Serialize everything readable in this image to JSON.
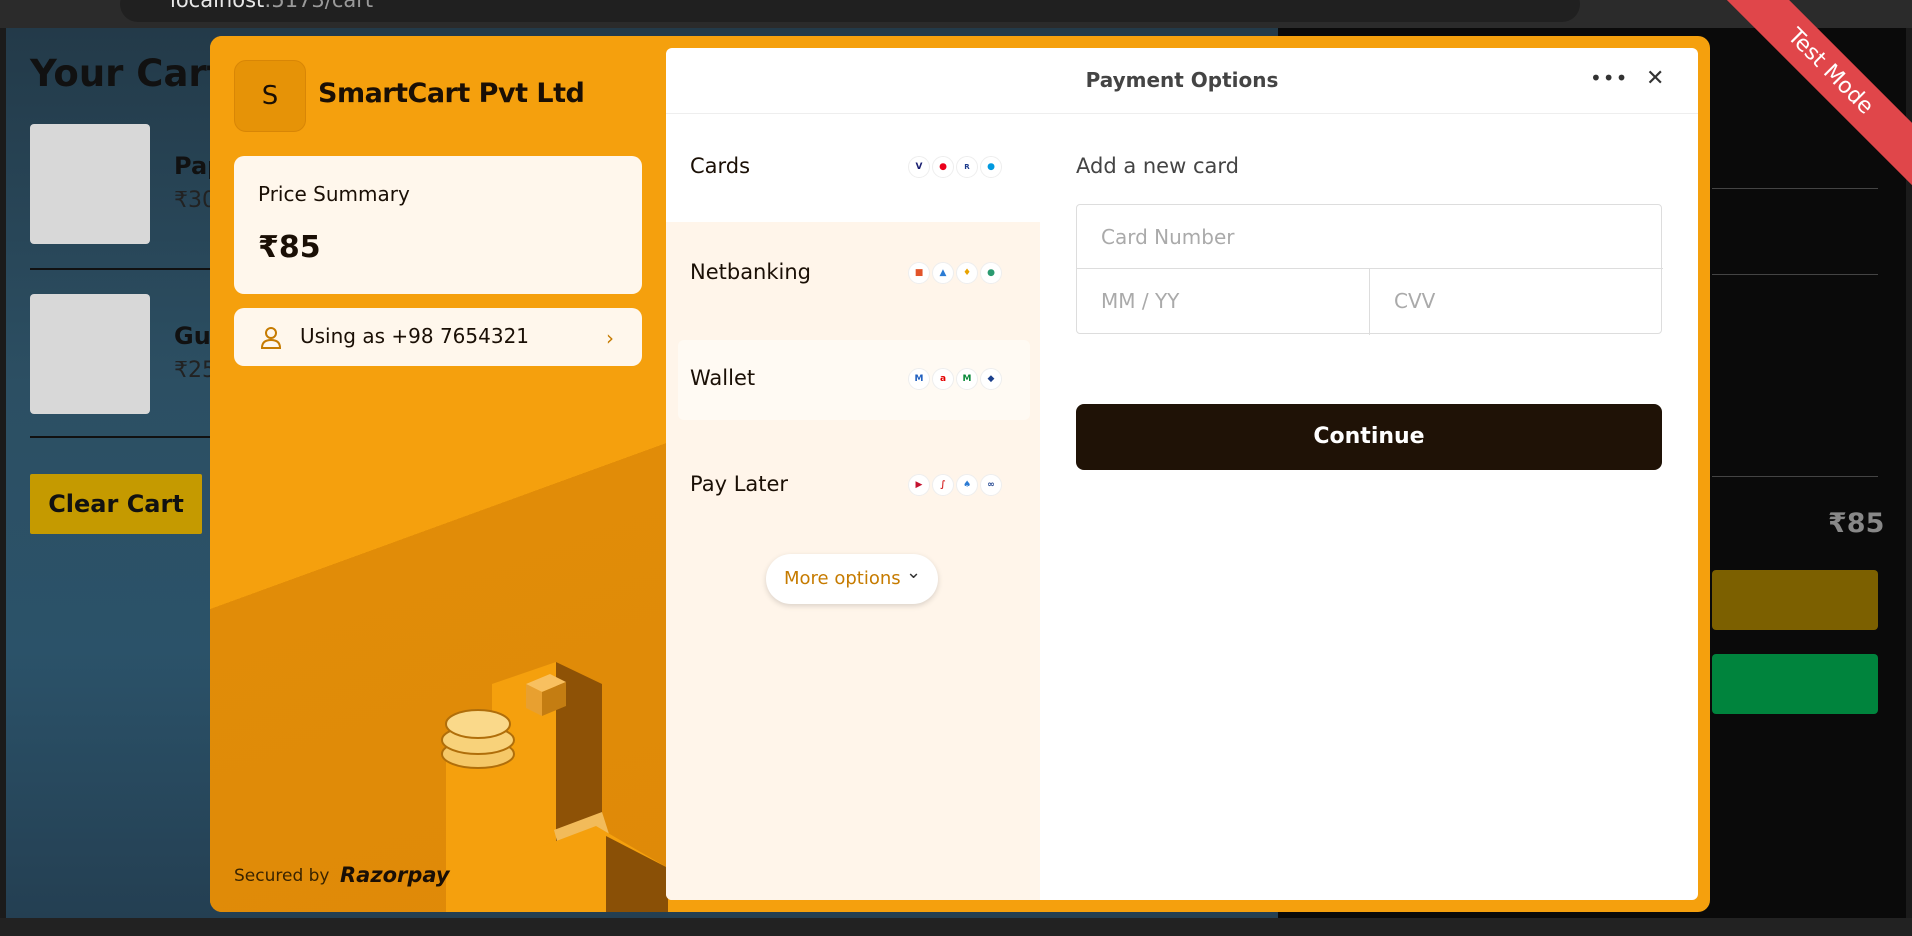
{
  "browser": {
    "url_host": "localhost",
    "url_path": ":5173/cart"
  },
  "page": {
    "title": "Your Cart",
    "items": [
      {
        "name": "Pap",
        "price": "₹30"
      },
      {
        "name": "Gu",
        "price": "₹25"
      }
    ],
    "clear_button": "Clear Cart",
    "summary_price": "₹85"
  },
  "checkout": {
    "test_mode_label": "Test Mode",
    "merchant": {
      "initial": "S",
      "name": "SmartCart Pvt Ltd"
    },
    "price_summary": {
      "label": "Price Summary",
      "amount": "₹85"
    },
    "user": {
      "text": "Using as +98 7654321"
    },
    "footer": {
      "secured_by": "Secured by",
      "brand": "Razorpay"
    },
    "header": {
      "title": "Payment Options",
      "more": "•••",
      "close": "✕"
    },
    "methods": [
      {
        "label": "Cards",
        "badges": [
          "VISA",
          "MC",
          "RuPay",
          "Maestro"
        ]
      },
      {
        "label": "Netbanking",
        "badges": [
          "Bank1",
          "Bank2",
          "Bank3",
          "Bank4"
        ]
      },
      {
        "label": "Wallet",
        "badges": [
          "Mobikwik",
          "Airtel",
          "M",
          "Freecharge"
        ]
      },
      {
        "label": "Pay Later",
        "badges": [
          "Simpl",
          "LazyPay",
          "Icici",
          "Zest"
        ]
      }
    ],
    "more_options": "More options",
    "card_form": {
      "title": "Add a new card",
      "card_number_placeholder": "Card Number",
      "expiry_placeholder": "MM / YY",
      "cvv_placeholder": "CVV",
      "continue": "Continue"
    }
  }
}
